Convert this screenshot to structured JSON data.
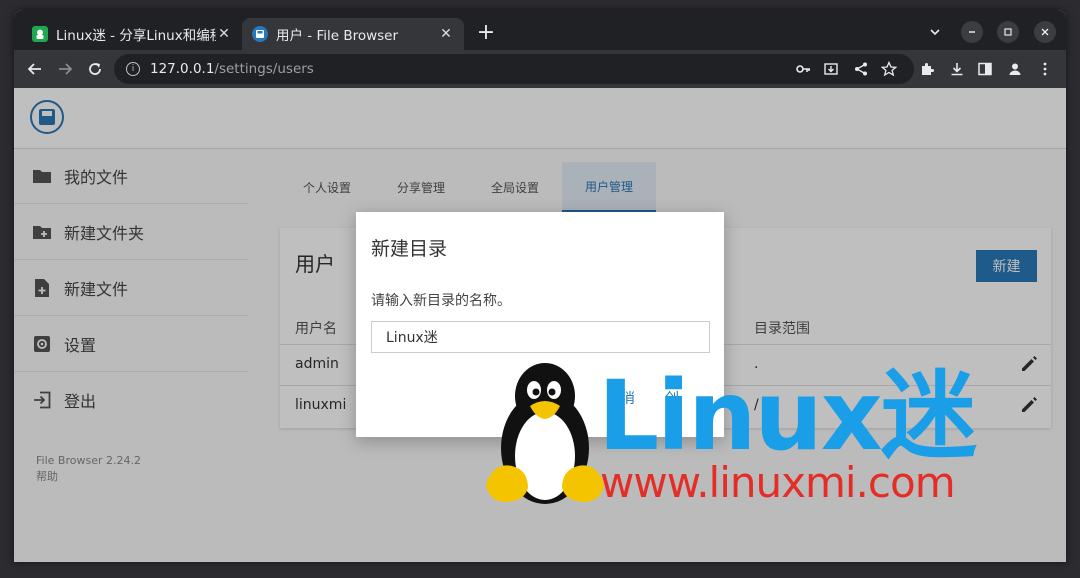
{
  "browser": {
    "tabs": [
      {
        "title": "Linux迷 - 分享Linux和编程",
        "active": false
      },
      {
        "title": "用户 - File Browser",
        "active": true
      }
    ],
    "close_glyph": "✕",
    "new_tab_glyph": "+",
    "url_host": "127.0.0.1",
    "url_path": "/settings/users",
    "window_controls": {
      "dropdown": "⌄",
      "minimize": "–",
      "maximize": "▢",
      "close": "✕"
    }
  },
  "sidebar": {
    "items": [
      {
        "label": "我的文件",
        "icon": "folder-icon"
      },
      {
        "label": "新建文件夹",
        "icon": "create-folder-icon"
      },
      {
        "label": "新建文件",
        "icon": "new-file-icon"
      },
      {
        "label": "设置",
        "icon": "settings-icon"
      },
      {
        "label": "登出",
        "icon": "logout-icon"
      }
    ],
    "version": "File Browser 2.24.2",
    "help": "帮助"
  },
  "settings_tabs": [
    {
      "label": "个人设置",
      "active": false
    },
    {
      "label": "分享管理",
      "active": false
    },
    {
      "label": "全局设置",
      "active": false
    },
    {
      "label": "用户管理",
      "active": true
    }
  ],
  "users_card": {
    "title": "用户",
    "new_button": "新建",
    "columns": [
      "用户名",
      "目录范围"
    ],
    "rows": [
      {
        "username": "admin",
        "scope": "."
      },
      {
        "username": "linuxmi",
        "scope": "/"
      }
    ]
  },
  "dialog": {
    "title": "新建目录",
    "message": "请输入新目录的名称。",
    "input_value": "Linux迷",
    "cancel_partial": "消",
    "create_partial": "创"
  },
  "watermark": {
    "brand": "Linux迷",
    "url": "www.linuxmi.com"
  },
  "colors": {
    "accent": "#2979b8",
    "watermark_blue": "#1a9ee8",
    "watermark_red": "#e52d27"
  }
}
